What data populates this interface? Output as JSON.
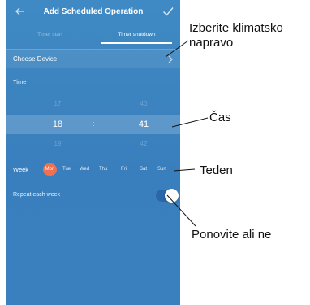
{
  "header": {
    "title": "Add Scheduled Operation",
    "back_icon": "arrow-left-icon",
    "confirm_icon": "checkmark-icon"
  },
  "tabs": [
    {
      "label": "Timer start",
      "active": false
    },
    {
      "label": "Timer shutdown",
      "active": true
    }
  ],
  "device": {
    "label": "Choose Device",
    "icon": "chevron-right-icon"
  },
  "time": {
    "label": "Time",
    "hour_prev": "17",
    "hour": "18",
    "hour_next": "19",
    "separator": ":",
    "minute_prev": "40",
    "minute": "41",
    "minute_next": "42"
  },
  "week": {
    "label": "Week",
    "days": [
      {
        "label": "Mon",
        "selected": true
      },
      {
        "label": "Tue",
        "selected": false
      },
      {
        "label": "Wed",
        "selected": false
      },
      {
        "label": "Thu",
        "selected": false
      },
      {
        "label": "Fri",
        "selected": false
      },
      {
        "label": "Sat",
        "selected": false
      },
      {
        "label": "Sun",
        "selected": false
      }
    ]
  },
  "repeat": {
    "label": "Repeat each week",
    "enabled": true
  },
  "annotations": {
    "device": "Izberite klimatsko napravo",
    "time": "Čas",
    "week": "Teden",
    "repeat": "Ponovite ali ne"
  },
  "colors": {
    "background": "#3a80be",
    "selected_day": "#f1704f",
    "toggle_track": "#2a67a8",
    "text": "#ffffff"
  }
}
